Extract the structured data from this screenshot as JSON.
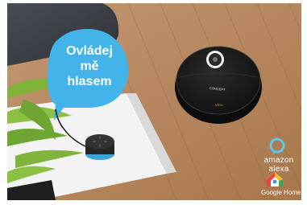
{
  "bubble": {
    "line1": "Ovládej",
    "line2": "mě",
    "line3": "hlasem"
  },
  "alexa": {
    "label": "amazon alexa"
  },
  "google_home": {
    "label": "Google Home"
  },
  "robot": {
    "brand": "CONCEPT",
    "model": "VR3x"
  },
  "colors": {
    "bubble": "#43b4e9",
    "floor": "#b9885e",
    "sofa": "#3c4147",
    "table": "#f2f2f2",
    "robot": "#1a1a1a",
    "alexa_icon": "#5ac8e6",
    "ghome_red": "#e8453c",
    "ghome_yellow": "#f9bb2d",
    "ghome_green": "#3aa757"
  }
}
